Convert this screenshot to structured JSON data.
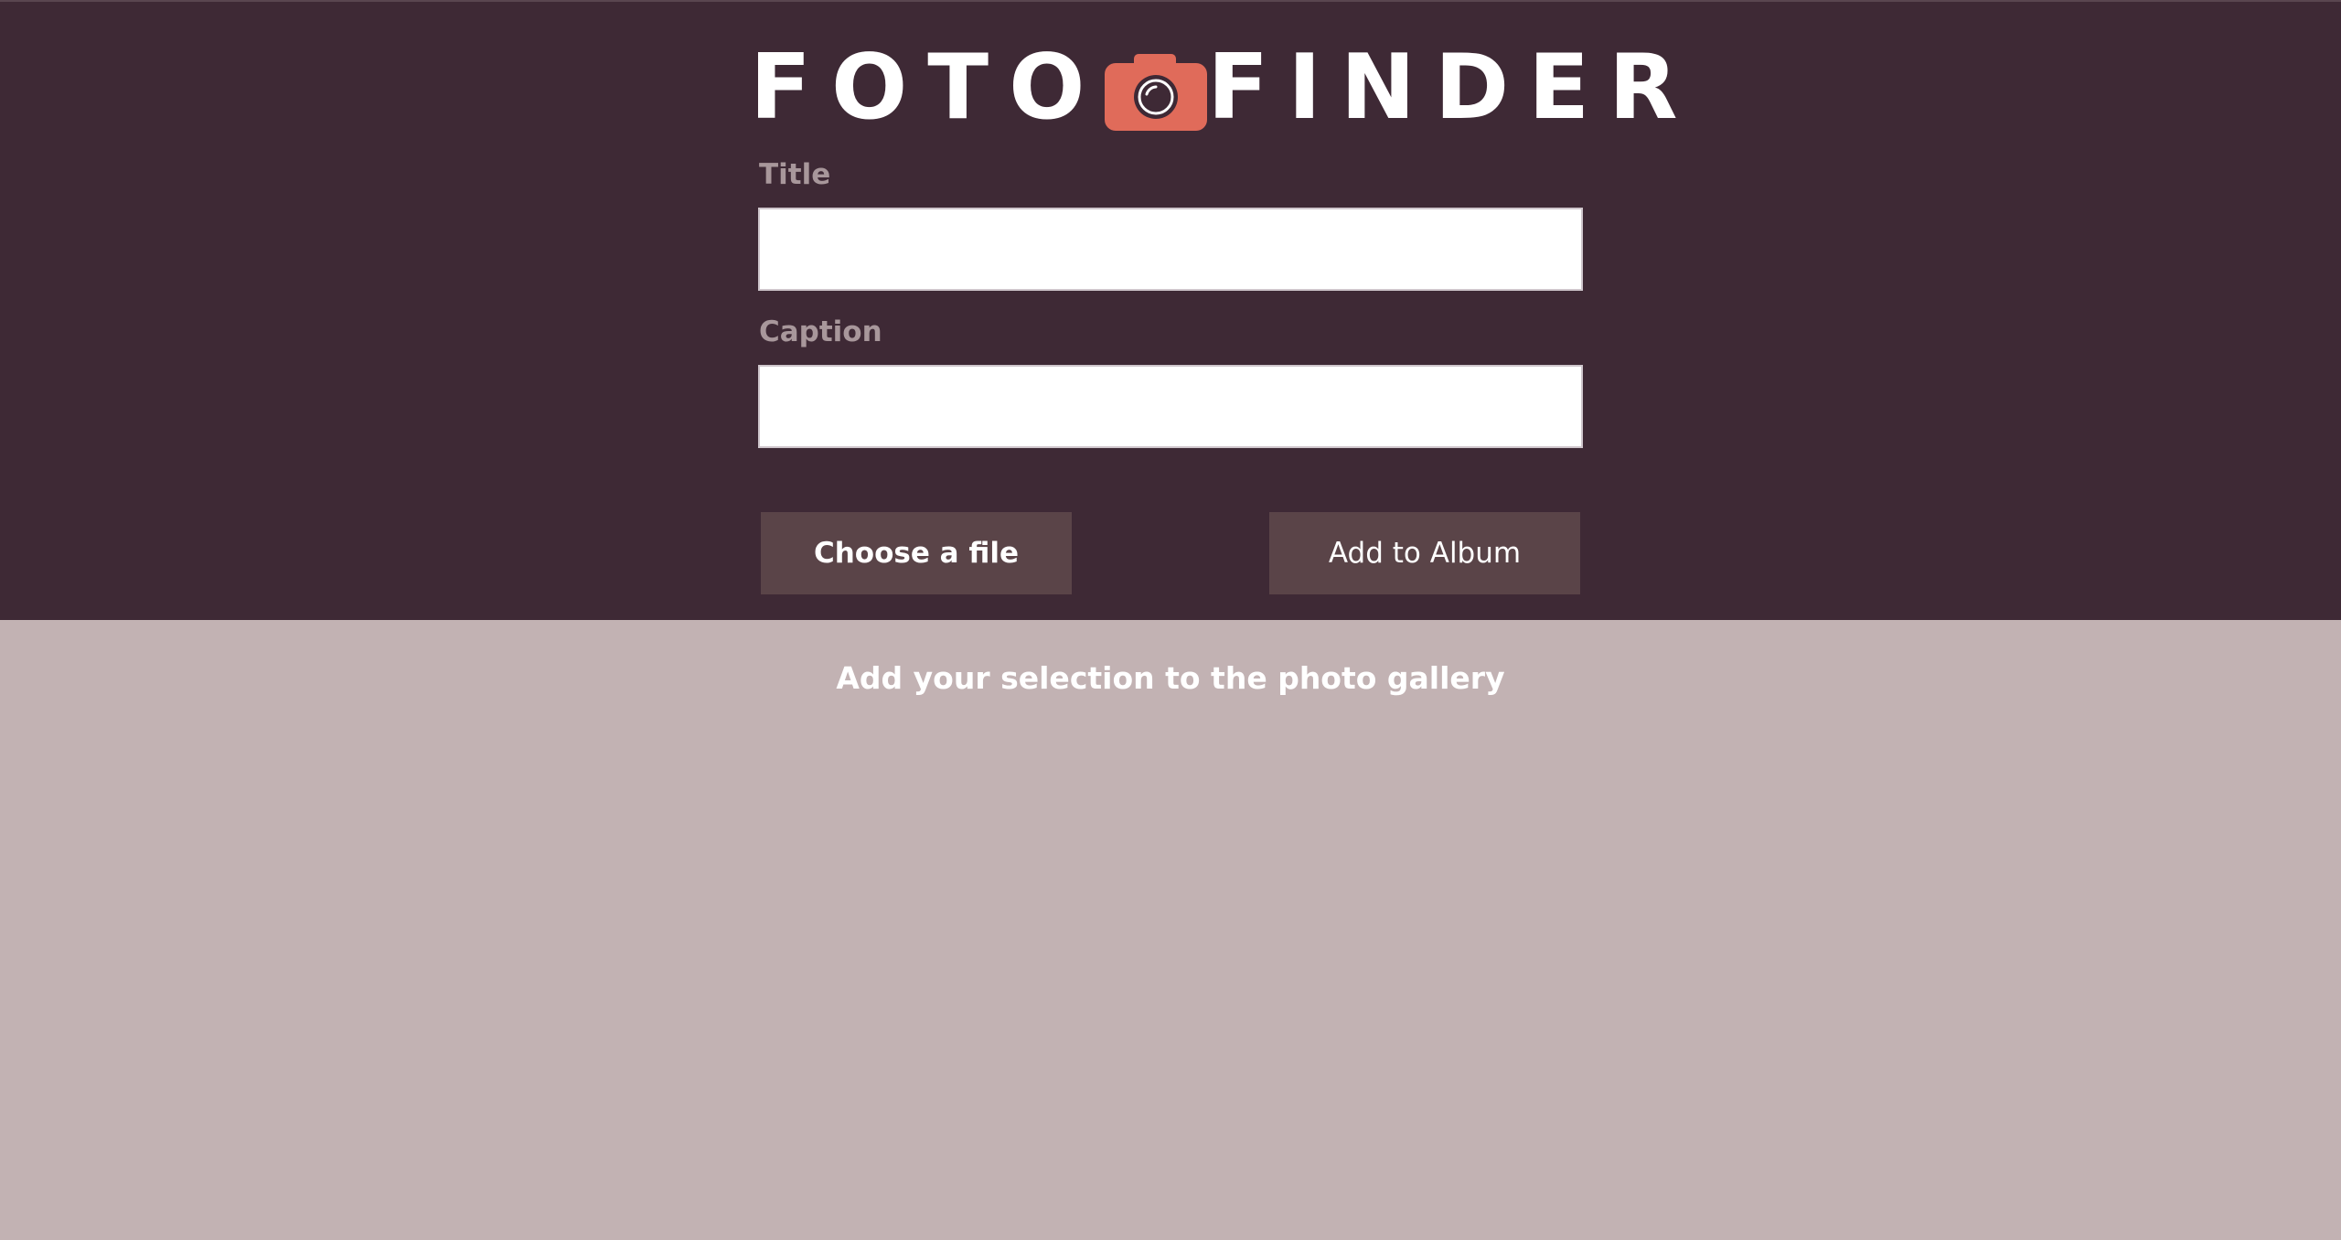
{
  "logo": {
    "word_left": "FOTO",
    "word_right": "FINDER",
    "icon": "camera-icon",
    "icon_color": "#e06b5a"
  },
  "form": {
    "title_label": "Title",
    "title_value": "",
    "caption_label": "Caption",
    "caption_value": ""
  },
  "buttons": {
    "choose_file": "Choose a file",
    "add_to_album": "Add to Album"
  },
  "gallery": {
    "message": "Add your selection to the photo gallery"
  },
  "colors": {
    "header_bg": "#3e2935",
    "body_bg": "#c2b2b3",
    "button_bg": "#5a4448",
    "label_color": "#a8979b"
  }
}
